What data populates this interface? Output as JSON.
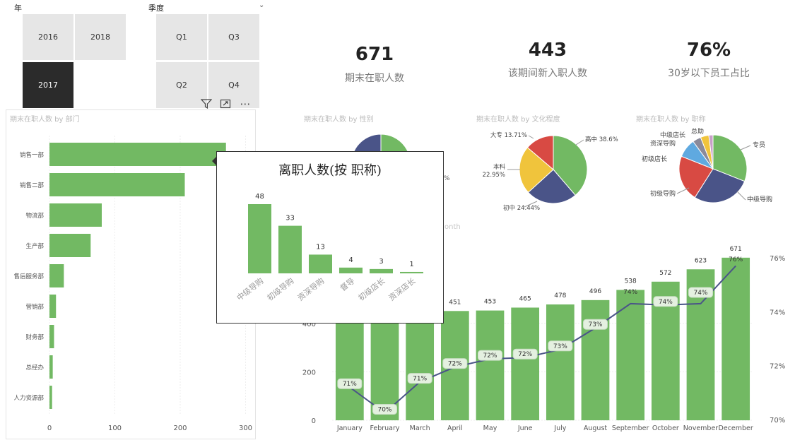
{
  "slicers": {
    "year": {
      "title": "年",
      "items": [
        "2016",
        "2018",
        "2017"
      ],
      "selected": "2017"
    },
    "quarter": {
      "title": "季度",
      "items": [
        "Q1",
        "Q3",
        "Q2",
        "Q4"
      ]
    }
  },
  "kpis": [
    {
      "value": "671",
      "label": "期末在职人数"
    },
    {
      "value": "443",
      "label": "该期间新入职人数"
    },
    {
      "value": "76%",
      "label": "30岁以下员工占比"
    }
  ],
  "titles": {
    "dept": "期末在职人数 by 部门",
    "gender": "期末在职人数 by 性别",
    "edu": "期末在职人数 by 文化程度",
    "job": "期末在职人数 by 职称",
    "month_partial": "onth"
  },
  "tooltip": {
    "title": "离职人数(按 职称)"
  },
  "colors": {
    "green": "#72b963",
    "navy": "#4a5488",
    "yellow": "#f0c43c",
    "red": "#d84a43",
    "lightblue": "#5fa9e0",
    "grey": "#8a8a9a"
  },
  "chart_data": [
    {
      "type": "bar",
      "name": "dept",
      "orientation": "horizontal",
      "categories": [
        "销售一部",
        "销售二部",
        "物流部",
        "生产部",
        "售后服务部",
        "营销部",
        "财务部",
        "总经办",
        "人力资源部"
      ],
      "values": [
        270,
        207,
        80,
        63,
        22,
        10,
        7,
        5,
        4
      ],
      "xlim": [
        0,
        310
      ],
      "xticks": [
        "0",
        "100",
        "200",
        "300"
      ]
    },
    {
      "type": "pie",
      "name": "edu",
      "categories": [
        "高中",
        "初中",
        "本科",
        "大专"
      ],
      "values": [
        38.6,
        24.44,
        22.95,
        13.71
      ],
      "labels": [
        "高中 38.6%",
        "初中 24.44%",
        "本科\n22.95%",
        "大专 13.71%"
      ]
    },
    {
      "type": "pie",
      "name": "job",
      "categories": [
        "专员",
        "中级导购",
        "初级导购",
        "初级店长",
        "资深导购",
        "中级店长",
        "总助"
      ],
      "values": [
        31,
        28,
        22,
        9,
        4,
        4,
        2
      ]
    },
    {
      "type": "bar",
      "name": "tooltip",
      "categories": [
        "中级导购",
        "初级导购",
        "资深导购",
        "督导",
        "初级店长",
        "资深店长"
      ],
      "values": [
        48,
        33,
        13,
        4,
        3,
        1
      ]
    },
    {
      "type": "bar",
      "name": "monthly",
      "categories": [
        "January",
        "February",
        "March",
        "April",
        "May",
        "June",
        "July",
        "August",
        "September",
        "October",
        "November",
        "December"
      ],
      "series": [
        {
          "values": [
            404,
            409,
            429,
            451,
            453,
            465,
            478,
            496,
            538,
            572,
            623,
            671
          ],
          "labels": [
            "404",
            "409",
            "429",
            "451",
            "453",
            "465",
            "478",
            "496",
            "538",
            "572",
            "623",
            "671"
          ]
        },
        {
          "type": "line",
          "values": [
            71,
            70,
            71,
            72,
            72,
            72,
            73,
            73,
            74,
            74,
            74,
            76
          ],
          "labels": [
            "71%",
            "70%",
            "71%",
            "72%",
            "72%",
            "72%",
            "73%",
            "73%",
            "74%",
            "74%",
            "74%",
            "76%"
          ],
          "values_precise": [
            71.2,
            70.25,
            71.4,
            71.95,
            72.25,
            72.3,
            72.6,
            73.4,
            74.3,
            74.25,
            74.3,
            75.7
          ]
        }
      ],
      "ylim": [
        0,
        720
      ],
      "yticks": [
        "0",
        "200",
        "400"
      ],
      "y2lim": [
        69.8,
        76.5
      ],
      "y2ticks": [
        "70%",
        "72%",
        "74%",
        "76%"
      ]
    }
  ]
}
